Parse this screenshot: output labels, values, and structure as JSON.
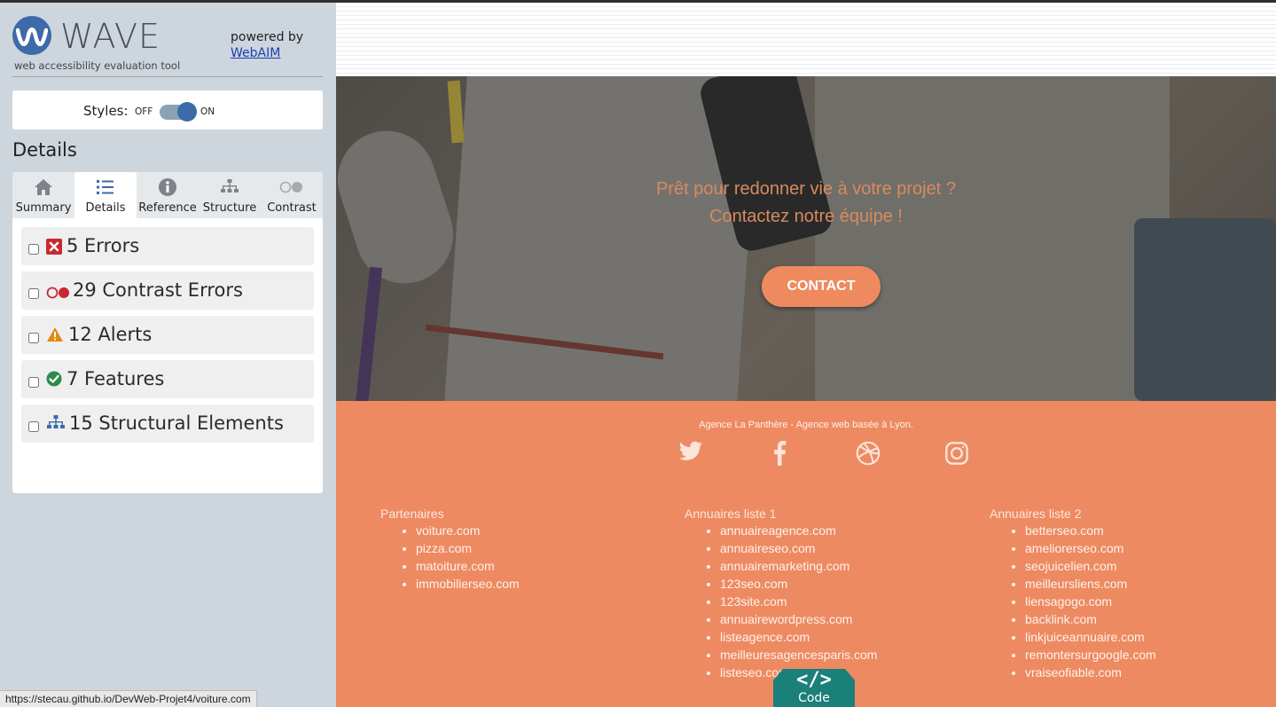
{
  "wave": {
    "logo_text": "WAVE",
    "tagline": "web accessibility evaluation tool",
    "powered_by": "powered by",
    "webaim_link": "WebAIM",
    "styles_label": "Styles:",
    "toggle_off": "OFF",
    "toggle_on": "ON",
    "styles_on": true,
    "details_title": "Details",
    "tabs": [
      {
        "label": "Summary",
        "icon": "home-icon"
      },
      {
        "label": "Details",
        "icon": "list-icon",
        "active": true
      },
      {
        "label": "Reference",
        "icon": "info-icon"
      },
      {
        "label": "Structure",
        "icon": "structure-icon"
      },
      {
        "label": "Contrast",
        "icon": "contrast-icon"
      }
    ],
    "categories": [
      {
        "label": "5 Errors",
        "icon": "error-icon",
        "color": "#c8292f"
      },
      {
        "label": "29 Contrast Errors",
        "icon": "contrast-error-icon",
        "color": "#c8292f"
      },
      {
        "label": "12 Alerts",
        "icon": "alert-icon",
        "color": "#e28a10"
      },
      {
        "label": "7 Features",
        "icon": "feature-icon",
        "color": "#2e8b4a"
      },
      {
        "label": "15 Structural Elements",
        "icon": "structure-icon",
        "color": "#3d6aa8"
      }
    ]
  },
  "status_url": "https://stecau.github.io/DevWeb-Projet4/voiture.com",
  "site": {
    "hero_line1": "Prêt pour redonner vie à votre projet ?",
    "hero_line2": "Contactez notre équipe !",
    "contact_button": "CONTACT",
    "footer_tagline": "Agence La Panthère - Agence web basée à Lyon.",
    "social": [
      "twitter-icon",
      "facebook-icon",
      "dribbble-icon",
      "instagram-icon"
    ],
    "columns": [
      {
        "title": "Partenaires",
        "items": [
          "voiture.com",
          "pizza.com",
          "matoiture.com",
          "immobilierseo.com"
        ]
      },
      {
        "title": "Annuaires liste 1",
        "items": [
          "annuaireagence.com",
          "annuaireseo.com",
          "annuairemarketing.com",
          "123seo.com",
          "123site.com",
          "annuairewordpress.com",
          "listeagence.com",
          "meilleuresagencesparis.com",
          "listeseo.com"
        ]
      },
      {
        "title": "Annuaires liste 2",
        "items": [
          "betterseo.com",
          "ameliorerseo.com",
          "seojuicelien.com",
          "meilleursliens.com",
          "liensagogo.com",
          "backlink.com",
          "linkjuiceannuaire.com",
          "remontersurgoogle.com",
          "vraiseofiable.com"
        ]
      }
    ]
  },
  "code_tab": {
    "symbol": "</>",
    "label": "Code"
  },
  "colors": {
    "wave_blue": "#3d6aa8",
    "footer_orange": "#ee8a61",
    "code_teal": "#1b7f7a"
  }
}
